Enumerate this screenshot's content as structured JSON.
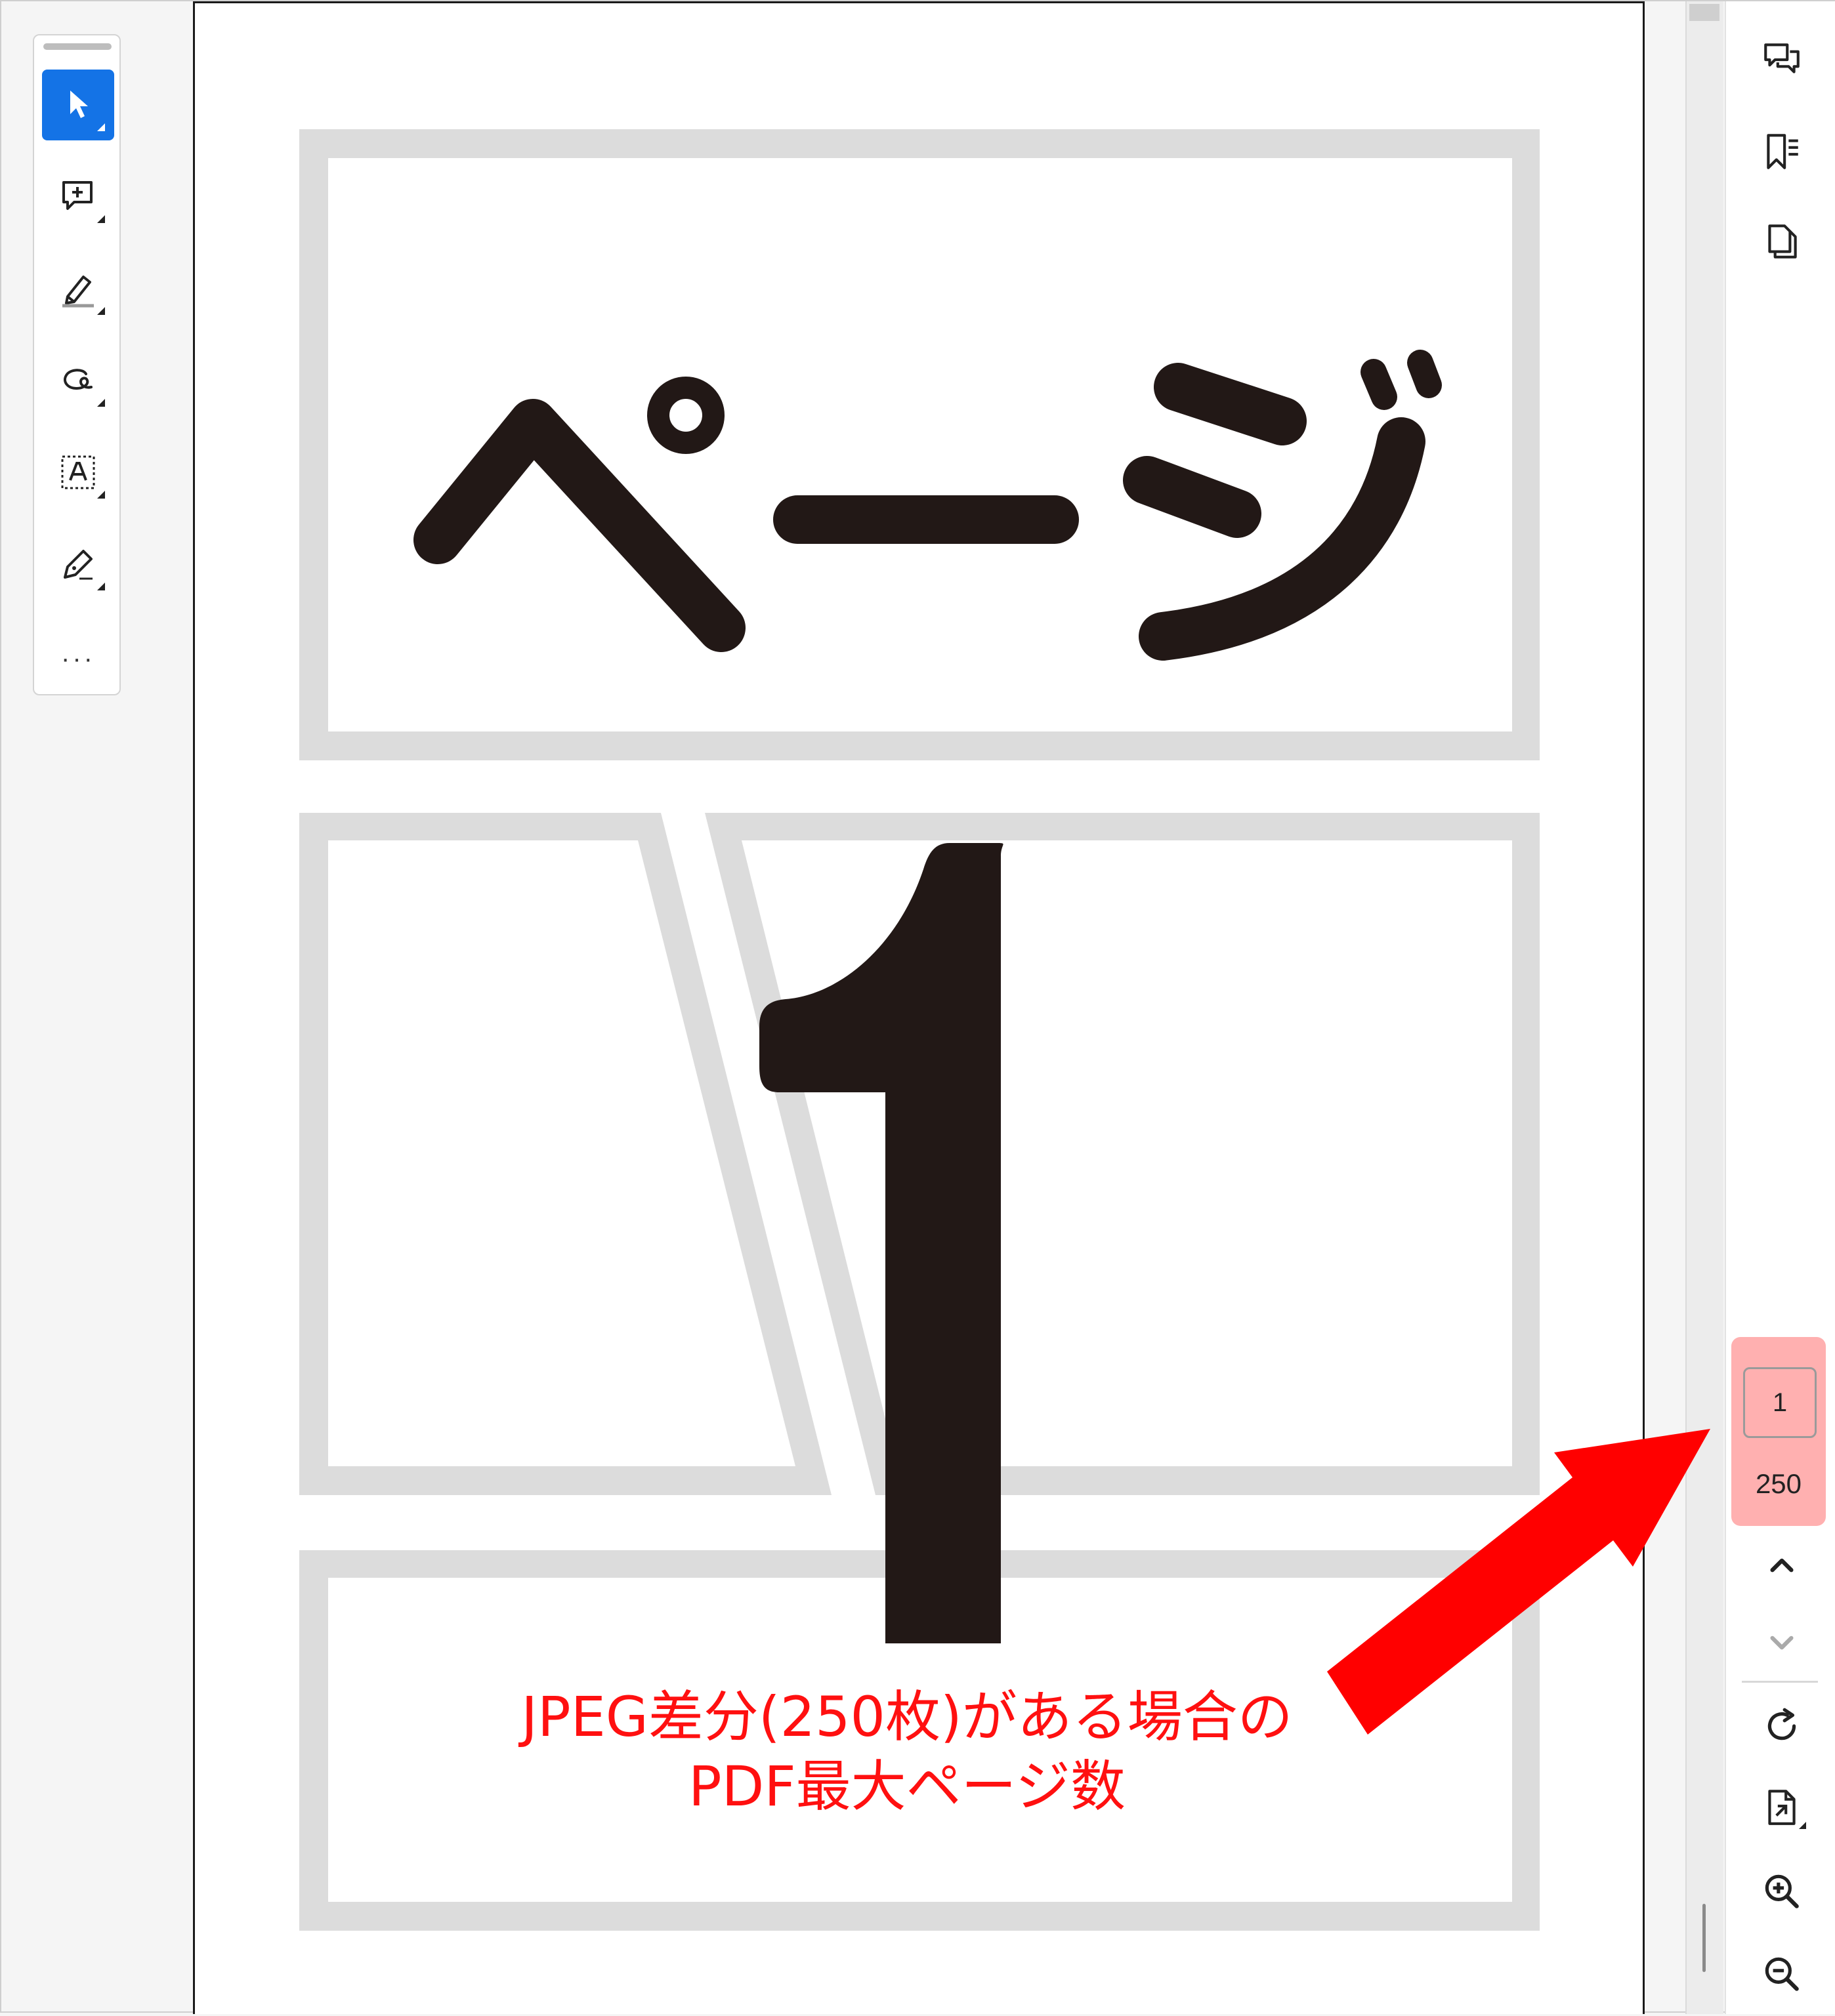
{
  "left_toolbar": {
    "tools": [
      {
        "name": "select-tool",
        "icon": "cursor-arrow-icon",
        "active": true
      },
      {
        "name": "add-comment-tool",
        "icon": "comment-plus-icon",
        "active": false
      },
      {
        "name": "highlight-tool",
        "icon": "highlighter-pen-icon",
        "active": false
      },
      {
        "name": "draw-tool",
        "icon": "freehand-lasso-icon",
        "active": false
      },
      {
        "name": "text-recognition-tool",
        "icon": "text-select-box-icon",
        "active": false
      },
      {
        "name": "sign-tool",
        "icon": "fountain-pen-icon",
        "active": false
      }
    ],
    "more_label": "···"
  },
  "document": {
    "heading_text": "ページ",
    "page_number_text": "1"
  },
  "right_panel": {
    "icons": [
      "comments-icon",
      "bookmarks-icon",
      "page-thumbnails-icon"
    ],
    "page_nav": {
      "current_page": "1",
      "total_pages": "250"
    },
    "bottom_icons": [
      "rotate-icon",
      "document-tools-icon",
      "zoom-in-icon",
      "zoom-out-icon"
    ]
  },
  "annotation": {
    "line1": "JPEG差分(250枚)がある場合の",
    "line2": "PDF最大ページ数",
    "color": "#ff1010"
  },
  "colors": {
    "accent": "#1473e6",
    "highlight": "#ffb0b0",
    "panel_border": "#dddddd",
    "frame_gray": "#dcdcdc",
    "ink": "#221816"
  }
}
